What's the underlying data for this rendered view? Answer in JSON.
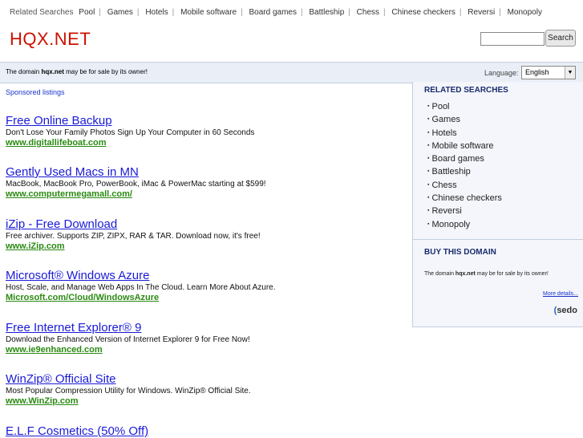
{
  "top_related": {
    "label": "Related Searches",
    "items": [
      "Pool",
      "Games",
      "Hotels",
      "Mobile software",
      "Board games",
      "Battleship",
      "Chess",
      "Chinese checkers",
      "Reversi",
      "Monopoly"
    ]
  },
  "logo": "HQX.NET",
  "search": {
    "button_label": "Search",
    "value": ""
  },
  "bar": {
    "notice_prefix": "The domain ",
    "notice_domain": "hqx.net",
    "notice_suffix": " may be for sale by its owner!",
    "language_label": "Language:",
    "language_value": "English"
  },
  "sponsored_label": "Sponsored listings",
  "listings": [
    {
      "title": "Free Online Backup",
      "desc": "Don't Lose Your Family Photos Sign Up Your Computer in 60 Seconds",
      "url": "www.digitallifeboat.com"
    },
    {
      "title": "Gently Used Macs in MN",
      "desc": "MacBook, MacBook Pro, PowerBook, iMac & PowerMac starting at $599!",
      "url": "www.computermegamall.com/"
    },
    {
      "title": "iZip - Free Download",
      "desc": "Free archiver. Supports ZIP, ZIPX, RAR & TAR. Download now, it's free!",
      "url": "www.iZip.com"
    },
    {
      "title": "Microsoft® Windows Azure",
      "desc": "Host, Scale, and Manage Web Apps In The Cloud. Learn More About Azure.",
      "url": "Microsoft.com/Cloud/WindowsAzure"
    },
    {
      "title": "Free Internet Explorer® 9",
      "desc": "Download the Enhanced Version of Internet Explorer 9 for Free Now!",
      "url": "www.ie9enhanced.com"
    },
    {
      "title": "WinZip® Official Site",
      "desc": "Most Popular Compression Utility for Windows. WinZip® Official Site.",
      "url": "www.WinZip.com"
    },
    {
      "title": "E.L.F Cosmetics (50% Off)",
      "desc": "",
      "url": ""
    }
  ],
  "sidebar": {
    "related_title": "RELATED SEARCHES",
    "related_items": [
      "Pool",
      "Games",
      "Hotels",
      "Mobile software",
      "Board games",
      "Battleship",
      "Chess",
      "Chinese checkers",
      "Reversi",
      "Monopoly"
    ],
    "buy_title": "BUY THIS DOMAIN",
    "buy_notice_prefix": "The domain ",
    "buy_notice_domain": "hqx.net",
    "buy_notice_suffix": " may be for sale by its owner!",
    "more_details": "More details...",
    "sedo_logo": "sedo"
  },
  "colors": {
    "logo": "#cc1100",
    "link_title": "#1a1ad6",
    "link_url": "#2a8a12",
    "bar_bg": "#e9eef7",
    "sidebar_bg": "#f4f6fb"
  }
}
